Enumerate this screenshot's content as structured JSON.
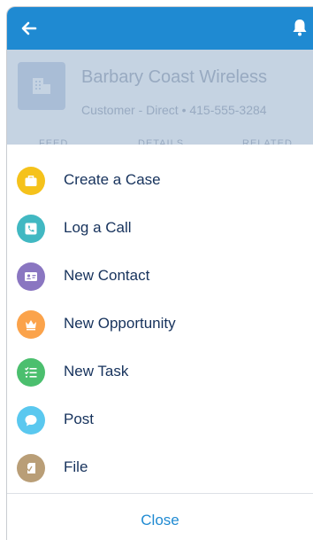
{
  "header": {
    "back_icon": "arrow-left-icon",
    "notification_icon": "bell-icon",
    "bar_color": "#1f8ad2"
  },
  "record": {
    "name": "Barbary Coast Wireless",
    "subtitle": "Customer - Direct  •  415-555-3284",
    "icon": "account-icon",
    "tabs": [
      "FEED",
      "DETAILS",
      "RELATED"
    ]
  },
  "actions": [
    {
      "label": "Create a Case",
      "icon": "briefcase-icon",
      "color": "#f5c21b"
    },
    {
      "label": "Log a Call",
      "icon": "phone-icon",
      "color": "#41b8c2"
    },
    {
      "label": "New Contact",
      "icon": "contact-card-icon",
      "color": "#8a76c1"
    },
    {
      "label": "New Opportunity",
      "icon": "crown-icon",
      "color": "#fba34b"
    },
    {
      "label": "New Task",
      "icon": "checklist-icon",
      "color": "#4bbf6e"
    },
    {
      "label": "Post",
      "icon": "speech-bubble-icon",
      "color": "#5ac8ef"
    },
    {
      "label": "File",
      "icon": "file-icon",
      "color": "#b99e77"
    }
  ],
  "close_label": "Close"
}
